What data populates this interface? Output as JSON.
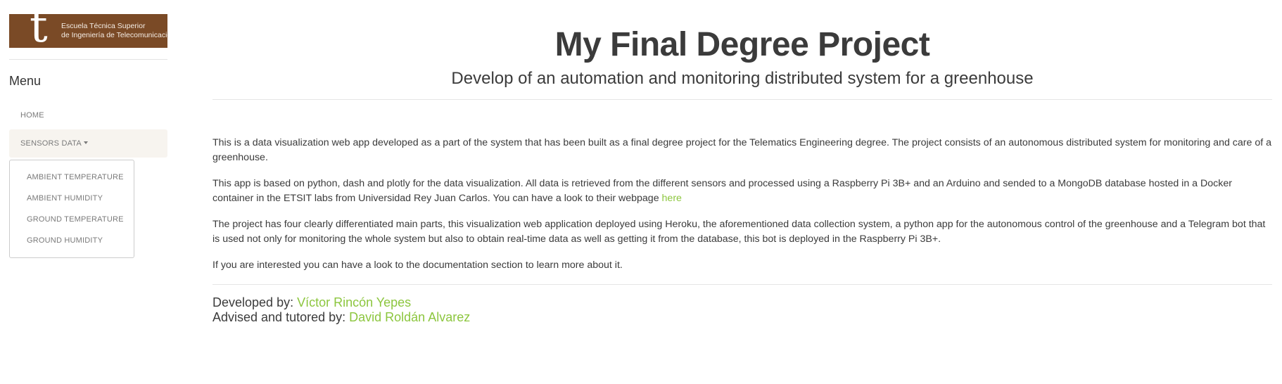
{
  "logo": {
    "letter": "t",
    "line1": "Escuela Técnica Superior",
    "line2": "de Ingeniería de Telecomunicación"
  },
  "sidebar": {
    "menu_title": "Menu",
    "items": [
      {
        "label": "HOME"
      },
      {
        "label": "SENSORS DATA"
      }
    ],
    "dropdown": [
      {
        "label": "AMBIENT TEMPERATURE"
      },
      {
        "label": "AMBIENT HUMIDITY"
      },
      {
        "label": "GROUND TEMPERATURE"
      },
      {
        "label": "GROUND HUMIDITY"
      }
    ]
  },
  "main": {
    "title": "My Final Degree Project",
    "subtitle": "Develop of an automation and monitoring distributed system for a greenhouse",
    "paragraphs": [
      "This is a data visualization web app developed as a part of the system that has been built as a final degree project for the Telematics Engineering degree. The project consists of an autonomous distributed system for monitoring and care of a greenhouse.",
      "This app is based on python, dash and plotly for the data visualization. All data is retrieved from the different sensors and processed using a Raspberry Pi 3B+ and an Arduino and sended to a MongoDB database hosted in a Docker container in the ETSIT labs from Universidad Rey Juan Carlos. You can have a look to their webpage ",
      "The project has four clearly differentiated main parts, this visualization web application deployed using Heroku, the aforementioned data collection system, a python app for the autonomous control of the greenhouse and a Telegram bot that is used not only for monitoring the whole system but also to obtain real-time data as well as getting it from the database, this bot is deployed in the Raspberry Pi 3B+.",
      "If you are interested you can have a look to the documentation section to learn more about it."
    ],
    "webpage_link": "here",
    "developed_label": "Developed by: ",
    "developer": "Víctor Rincón Yepes",
    "advised_label": "Advised and tutored by: ",
    "advisor": "David Roldán Alvarez"
  },
  "colors": {
    "logo_bg": "#7a4a26",
    "link": "#8cc63e",
    "text": "#3b3b3b",
    "active_nav_bg": "#f7f4ef"
  }
}
